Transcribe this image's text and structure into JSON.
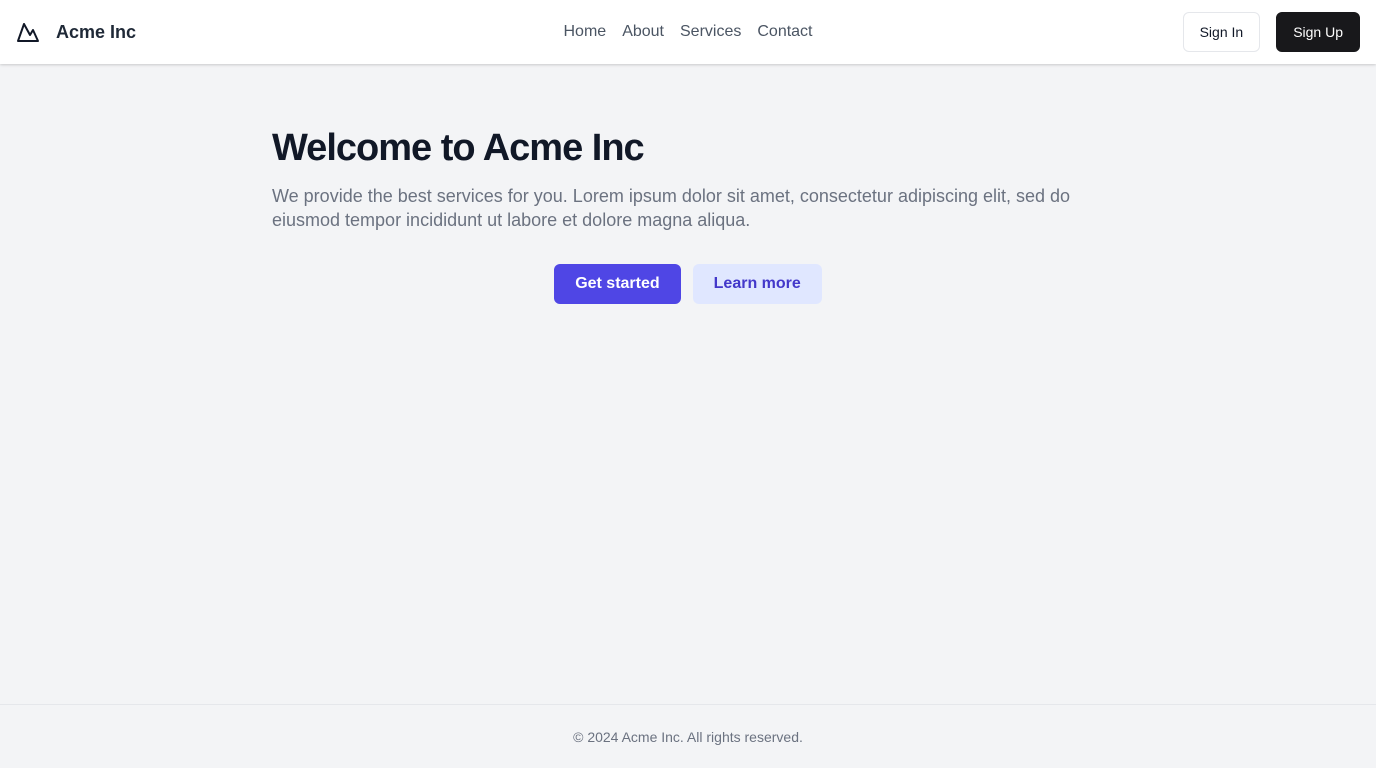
{
  "header": {
    "brand_name": "Acme Inc",
    "logo_icon": "mountain-icon",
    "nav": [
      {
        "label": "Home"
      },
      {
        "label": "About"
      },
      {
        "label": "Services"
      },
      {
        "label": "Contact"
      }
    ],
    "sign_in_label": "Sign In",
    "sign_up_label": "Sign Up"
  },
  "hero": {
    "title": "Welcome to Acme Inc",
    "description": "We provide the best services for you. Lorem ipsum dolor sit amet, consectetur adipiscing elit, sed do eiusmod tempor incididunt ut labore et dolore magna aliqua.",
    "primary_cta": "Get started",
    "secondary_cta": "Learn more"
  },
  "footer": {
    "copyright": "© 2024 Acme Inc. All rights reserved."
  },
  "colors": {
    "background": "#f3f4f6",
    "primary": "#4f46e5",
    "secondary_bg": "#e0e7ff",
    "secondary_text": "#4338ca",
    "dark_button": "#18181b"
  }
}
